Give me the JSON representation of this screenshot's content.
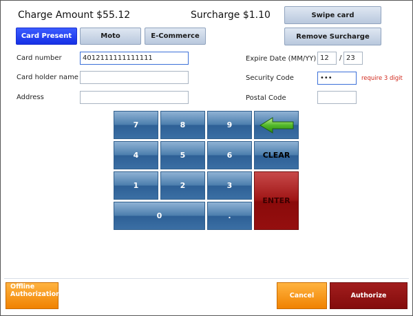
{
  "header": {
    "charge_amount": "Charge Amount $55.12",
    "surcharge": "Surcharge $1.10",
    "swipe_card": "Swipe card",
    "remove_surcharge": "Remove Surcharge"
  },
  "tabs": [
    {
      "label": "Card Present",
      "active": true
    },
    {
      "label": "Moto",
      "active": false
    },
    {
      "label": "E-Commerce",
      "active": false
    }
  ],
  "form": {
    "card_number": {
      "label": "Card number",
      "value": "4012111111111111"
    },
    "card_holder": {
      "label": "Card holder name",
      "value": ""
    },
    "address": {
      "label": "Address",
      "value": ""
    },
    "expire": {
      "label": "Expire Date (MM/YY)",
      "month": "12",
      "separator": "/",
      "year": "23"
    },
    "security": {
      "label": "Security Code",
      "value": "•••",
      "hint": "require 3 digit"
    },
    "postal": {
      "label": "Postal Code",
      "value": ""
    }
  },
  "keypad": {
    "keys": [
      "7",
      "8",
      "9",
      "4",
      "5",
      "6",
      "1",
      "2",
      "3",
      "0",
      "."
    ],
    "clear": "CLEAR",
    "enter": "ENTER"
  },
  "footer": {
    "offline_line1": "Offline",
    "offline_line2": "Authorization",
    "cancel": "Cancel",
    "authorize": "Authorize"
  },
  "colors": {
    "active_tab": "#1530e6",
    "keypad_blue": "#3b6fa4",
    "enter_red": "#8a0a0a",
    "orange": "#f08200",
    "authorize_red": "#840c0c",
    "warning": "#d0261a"
  }
}
